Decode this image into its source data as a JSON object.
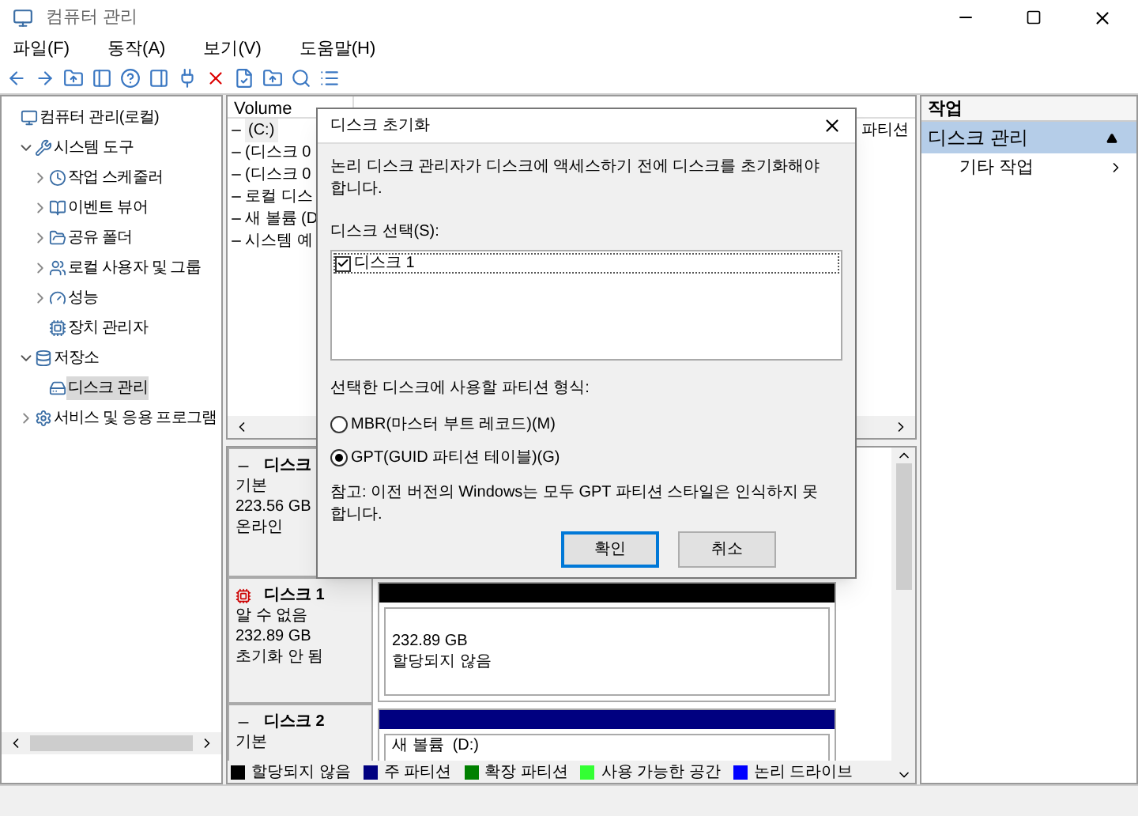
{
  "window": {
    "title": "컴퓨터 관리"
  },
  "menu": [
    "파일(F)",
    "동작(A)",
    "보기(V)",
    "도움말(H)"
  ],
  "tree": [
    {
      "label": "컴퓨터 관리(로컬)",
      "selected": false,
      "children": [
        {
          "label": "시스템 도구",
          "expanded": true,
          "selected": false,
          "children": [
            {
              "label": "작업 스케줄러",
              "expanded": false,
              "selected": false
            },
            {
              "label": "이벤트 뷰어",
              "expanded": false,
              "selected": false
            },
            {
              "label": "공유 폴더",
              "expanded": false,
              "selected": false
            },
            {
              "label": "로컬 사용자 및 그룹",
              "expanded": false,
              "selected": false
            },
            {
              "label": "성능",
              "expanded": false,
              "selected": false
            },
            {
              "label": "장치 관리자",
              "selected": false
            }
          ]
        },
        {
          "label": "저장소",
          "expanded": true,
          "selected": false,
          "children": [
            {
              "label": "디스크 관리",
              "selected": true
            }
          ]
        },
        {
          "label": "서비스 및 응용 프로그램",
          "expanded": false,
          "selected": false
        }
      ]
    }
  ],
  "volume_list": {
    "columns": [
      "Volume"
    ],
    "rows": [
      {
        "volume": "(C:)",
        "column_6": "파티션",
        "selected": true
      },
      {
        "volume": "(디스크 0",
        "selected": false
      },
      {
        "volume": "(디스크 0",
        "selected": false
      },
      {
        "volume": "로컬 디스",
        "selected": false
      },
      {
        "volume": "새 볼륨 (D",
        "selected": false
      },
      {
        "volume": "시스템 예",
        "selected": false
      }
    ]
  },
  "disks": [
    {
      "name": "디스크",
      "kind": "online",
      "type": "기본",
      "size": "223.56 GB",
      "status": "온라인"
    },
    {
      "name": "디스크 1",
      "kind": "error",
      "type": "알 수 없음",
      "size": "232.89 GB",
      "status": "초기화 안 됨",
      "partitions": [
        {
          "size": "232.89 GB",
          "label": "할당되지 않음",
          "color": "#000000"
        }
      ]
    },
    {
      "name": "디스크 2",
      "kind": "online",
      "type": "기본",
      "partitions": [
        {
          "label": "새 볼륨  (D:)",
          "color": "#000080"
        }
      ]
    }
  ],
  "legend": [
    {
      "label": "할당되지 않음",
      "color": "#000000"
    },
    {
      "label": "주 파티션",
      "color": "#000080"
    },
    {
      "label": "확장 파티션",
      "color": "#008000"
    },
    {
      "label": "사용 가능한 공간",
      "color": "#33ff33"
    },
    {
      "label": "논리 드라이브",
      "color": "#0000ff"
    }
  ],
  "actions": {
    "title": "작업",
    "items": [
      {
        "label": "디스크 관리",
        "kind": "header"
      },
      {
        "label": "기타 작업",
        "kind": "submenu"
      }
    ]
  },
  "dialog": {
    "title": "디스크 초기화",
    "message": "논리 디스크 관리자가 디스크에 액세스하기 전에 디스크를 초기화해야 합니다.",
    "disk_select_label": "디스크 선택(S):",
    "disks": [
      {
        "label": "디스크 1",
        "checked": true
      }
    ],
    "partition_style_label": "선택한 디스크에 사용할 파티션 형식:",
    "options": [
      {
        "label": "MBR(마스터 부트 레코드)(M)",
        "selected": false
      },
      {
        "label": "GPT(GUID 파티션 테이블)(G)",
        "selected": true
      }
    ],
    "note": "참고: 이전 버전의 Windows는 모두 GPT 파티션 스타일은 인식하지 못합니다.",
    "buttons": [
      {
        "label": "확인",
        "kind": "primary"
      },
      {
        "label": "취소",
        "kind": "secondary"
      }
    ]
  }
}
